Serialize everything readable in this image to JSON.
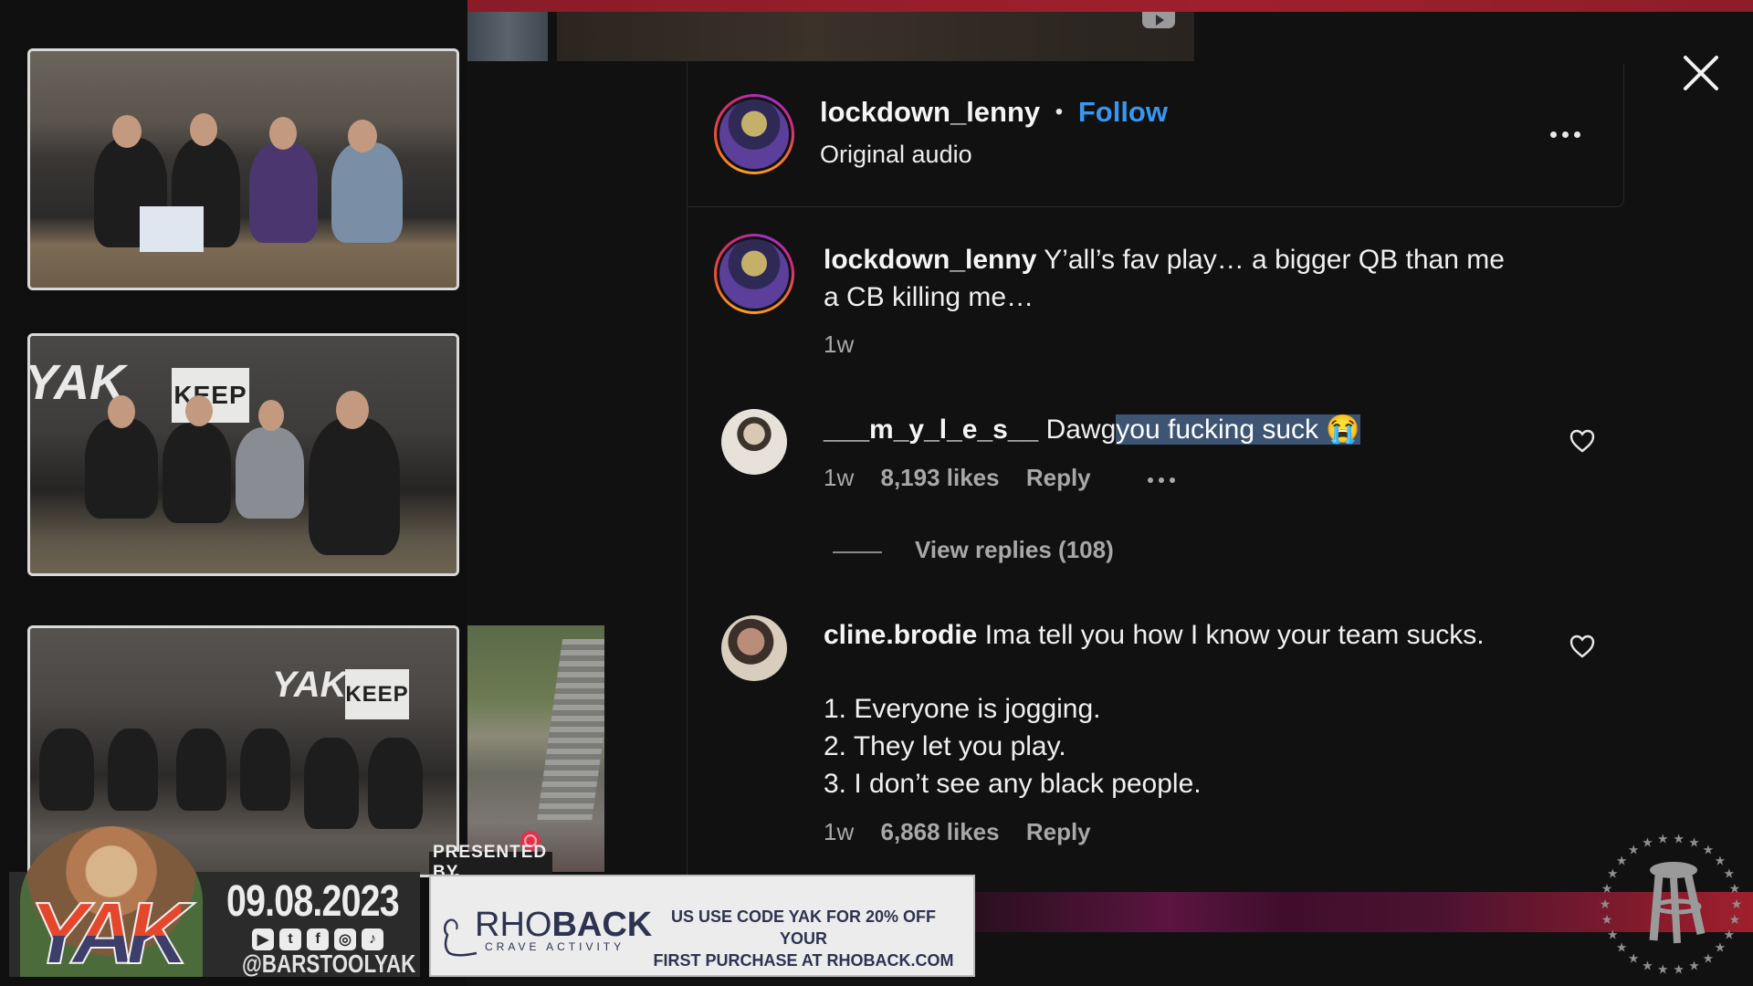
{
  "overlay": {
    "close_icon": "close-icon",
    "more_icon": "more-horizontal-icon",
    "heart_icon": "heart-outline-icon"
  },
  "post_header": {
    "username": "lockdown_lenny",
    "separator": "•",
    "follow_label": "Follow",
    "audio_label": "Original audio"
  },
  "caption": {
    "username": "lockdown_lenny",
    "text_line1": "Y’all’s fav play… a bigger QB than me",
    "text_line2": "a CB killing me…",
    "time": "1w"
  },
  "comments": [
    {
      "username": "___m_y_l_e_s__",
      "text_plain": "Dawg",
      "text_selected": "you fucking suck 😭",
      "time": "1w",
      "likes": "8,193 likes",
      "reply_label": "Reply",
      "view_replies_label": "View replies (108)"
    },
    {
      "username": "cline.brodie",
      "text_first_line": "Ima tell you how I know your team sucks.",
      "list_items": [
        "1. Everyone is jogging.",
        "2. They let you play.",
        "3. I don’t see any black people."
      ],
      "time": "1w",
      "likes": "6,868 likes",
      "reply_label": "Reply"
    }
  ],
  "stream_overlay": {
    "cam_signs": [
      "KEEP",
      "KEEP"
    ],
    "wall_logo": "YAK",
    "show_logo": "YAK",
    "date": "09.08.2023",
    "social_icons": [
      "youtube-icon",
      "twitter-icon",
      "facebook-icon",
      "instagram-icon",
      "tiktok-icon"
    ],
    "social_glyphs": [
      "▶",
      "t",
      "f",
      "◎",
      "♪"
    ],
    "handle": "@BARSTOOLYAK",
    "presented_by": "PRESENTED BY",
    "sponsor_name_light": "RHO",
    "sponsor_name_bold": "BACK",
    "sponsor_tagline": "CRAVE ACTIVITY",
    "ad_line1": "US USE CODE YAK FOR 20% OFF YOUR",
    "ad_line2": "FIRST PURCHASE AT RHOBACK.COM"
  },
  "colors": {
    "follow": "#3897f0",
    "selection": "#3d5573",
    "panel_bg": "#111111",
    "accent_red": "#a01f2c"
  }
}
